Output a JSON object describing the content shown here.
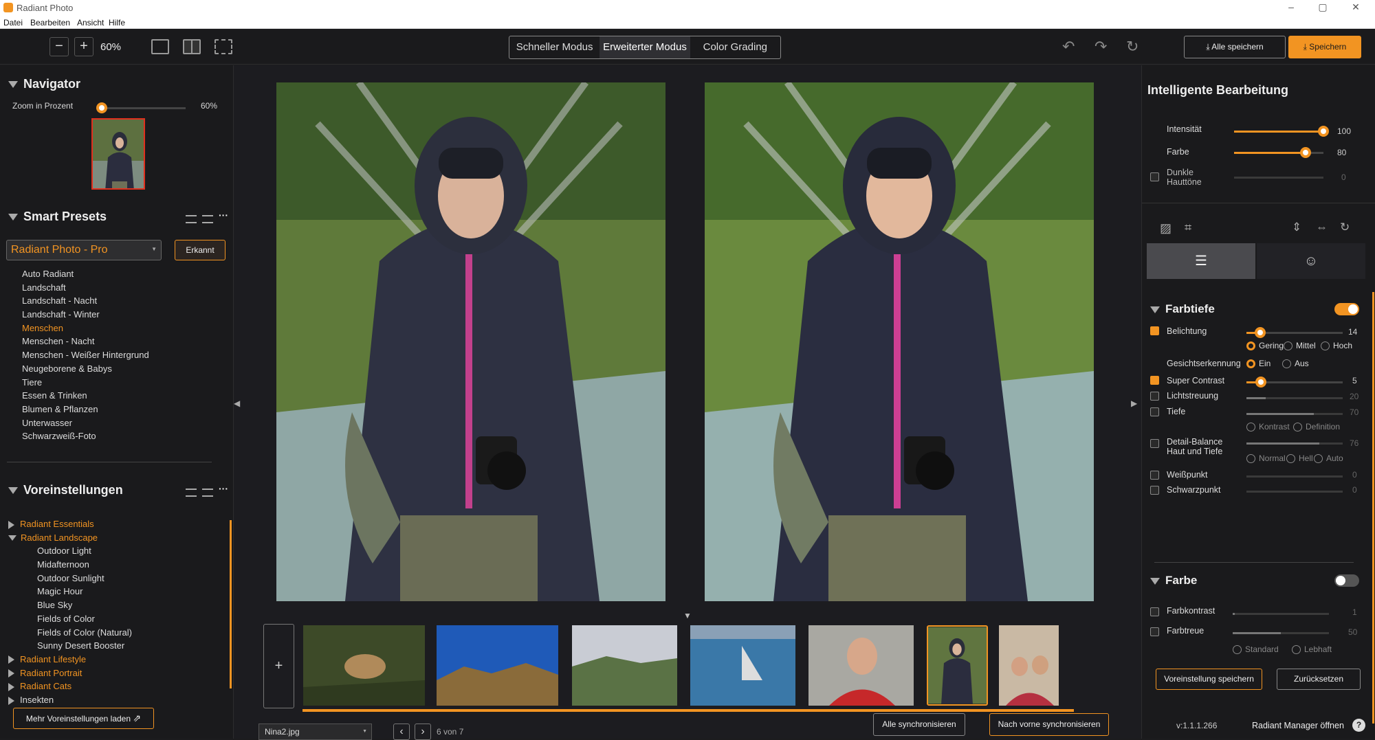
{
  "app": {
    "title": "Radiant Photo",
    "window_controls": [
      "–",
      "▢",
      "✕"
    ]
  },
  "menu": [
    "Datei",
    "Bearbeiten",
    "Ansicht",
    "Hilfe"
  ],
  "toolbar": {
    "zoom_out": "−",
    "zoom_in": "+",
    "zoom": "60%",
    "modes": [
      "Schneller Modus",
      "Erweiterter Modus",
      "Color Grading"
    ],
    "active_mode": 1,
    "save_all": "Alle speichern",
    "save": "Speichern",
    "undo": "↶",
    "redo": "↷",
    "reset": "↻",
    "save_icon": "⤓"
  },
  "navigator": {
    "title": "Navigator",
    "zoom_label": "Zoom in Prozent",
    "zoom_value": "60%",
    "zoom_fraction": 0.06
  },
  "smart_presets": {
    "title": "Smart Presets",
    "dropdown": "Radiant Photo - Pro",
    "recognized_btn": "Erkannt",
    "items": [
      "Auto Radiant",
      "Landschaft",
      "Landschaft - Nacht",
      "Landschaft - Winter",
      "Menschen",
      "Menschen - Nacht",
      "Menschen - Weißer Hintergrund",
      "Neugeborene & Babys",
      "Tiere",
      "Essen & Trinken",
      "Blumen & Pflanzen",
      "Unterwasser",
      "Schwarzweiß-Foto"
    ],
    "active": 4
  },
  "voreinstellungen": {
    "title": "Voreinstellungen",
    "groups": [
      {
        "label": "Radiant Essentials",
        "open": false,
        "children": []
      },
      {
        "label": "Radiant Landscape",
        "open": true,
        "children": [
          "Outdoor Light",
          "Midafternoon",
          "Outdoor Sunlight",
          "Magic Hour",
          "Blue Sky",
          "Fields of Color",
          "Fields of Color (Natural)",
          "Sunny Desert Booster"
        ]
      },
      {
        "label": "Radiant Lifestyle",
        "open": false,
        "children": []
      },
      {
        "label": "Radiant Portrait",
        "open": false,
        "children": []
      },
      {
        "label": "Radiant Cats",
        "open": false,
        "children": []
      },
      {
        "label": "Insekten",
        "open": false,
        "children": [],
        "white": true
      }
    ],
    "load_more": "Mehr Voreinstellungen laden"
  },
  "filmstrip": {
    "add": "+",
    "file": "Nina2.jpg",
    "counter": "6 von 7",
    "sync_all": "Alle synchronisieren",
    "sync_forward": "Nach vorne synchronisieren",
    "prev": "‹",
    "next": "›"
  },
  "smart_edit": {
    "title": "Intelligente Bearbeitung",
    "sliders": [
      {
        "label": "Intensität",
        "value": "100",
        "fraction": 1.0,
        "checkbox": false
      },
      {
        "label": "Farbe",
        "value": "80",
        "fraction": 0.8,
        "checkbox": false
      },
      {
        "label": "Dunkle Hauttöne",
        "value": "0",
        "fraction": 0.0,
        "checkbox": true,
        "disabled": true
      }
    ]
  },
  "farbtiefe": {
    "title": "Farbtiefe",
    "enabled": true,
    "belichtung": {
      "label": "Belichtung",
      "value": "14",
      "fraction": 0.14,
      "checked": true
    },
    "belichtung_opts": [
      "Gering",
      "Mittel",
      "Hoch"
    ],
    "face": {
      "label": "Gesichtserkennung",
      "opts": [
        "Ein",
        "Aus"
      ]
    },
    "super_contrast": {
      "label": "Super Contrast",
      "value": "5",
      "fraction": 0.15,
      "checked": true
    },
    "lichtstreuung": {
      "label": "Lichtstreuung",
      "value": "20",
      "fraction": 0.2
    },
    "tiefe": {
      "label": "Tiefe",
      "value": "70",
      "fraction": 0.7
    },
    "tiefe_opts": [
      "Kontrast",
      "Definition"
    ],
    "detail": {
      "label1": "Detail-Balance",
      "label2": "Haut und Tiefe",
      "value": "76",
      "fraction": 0.76
    },
    "detail_opts": [
      "Normal",
      "Hell",
      "Auto"
    ],
    "weiss": {
      "label": "Weißpunkt",
      "value": "0",
      "fraction": 0
    },
    "schwarz": {
      "label": "Schwarzpunkt",
      "value": "0",
      "fraction": 0
    }
  },
  "farbe": {
    "title": "Farbe",
    "enabled": false,
    "kontrast": {
      "label": "Farbkontrast",
      "value": "1",
      "fraction": 0.02
    },
    "treue": {
      "label": "Farbtreue",
      "value": "50",
      "fraction": 0.5
    },
    "opts": [
      "Standard",
      "Lebhaft"
    ],
    "save_preset": "Voreinstellung speichern",
    "reset": "Zurücksetzen"
  },
  "footer": {
    "version": "v:1.1.1.266",
    "manager": "Radiant Manager öffnen",
    "help": "?"
  },
  "colors": {
    "accent": "#f29422",
    "bg": "#1a1a1c"
  }
}
